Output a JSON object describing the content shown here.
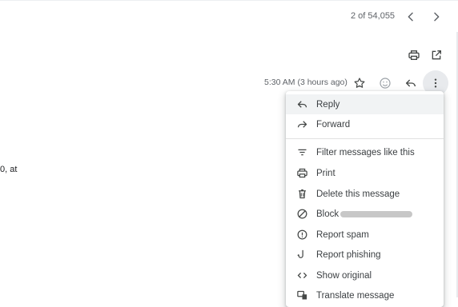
{
  "toolbar": {
    "pager_text": "2 of 54,055",
    "prev_icon": "chevron-left-icon",
    "next_icon": "chevron-right-icon",
    "print_icon": "print-icon",
    "open_new_window_icon": "open-in-new-window-icon"
  },
  "message_header": {
    "time": "5:30 AM (3 hours ago)",
    "star_icon": "star-icon",
    "emoji_icon": "emoji-icon",
    "reply_icon": "reply-icon",
    "more_icon": "more-vertical-icon"
  },
  "body_fragment": "0, at",
  "menu": {
    "items": [
      {
        "label": "Reply",
        "icon": "reply-icon"
      },
      {
        "label": "Forward",
        "icon": "forward-icon"
      },
      {
        "label": "Filter messages like this",
        "icon": "filter-icon"
      },
      {
        "label": "Print",
        "icon": "print-icon"
      },
      {
        "label": "Delete this message",
        "icon": "trash-icon"
      },
      {
        "label": "Block",
        "icon": "block-icon"
      },
      {
        "label": "Report spam",
        "icon": "report-spam-icon"
      },
      {
        "label": "Report phishing",
        "icon": "phishing-hook-icon"
      },
      {
        "label": "Show original",
        "icon": "code-icon"
      },
      {
        "label": "Translate message",
        "icon": "translate-icon"
      }
    ]
  },
  "colors": {
    "icon": "#5f6368",
    "text": "#3c4043",
    "highlight": "#f1f3f4"
  }
}
